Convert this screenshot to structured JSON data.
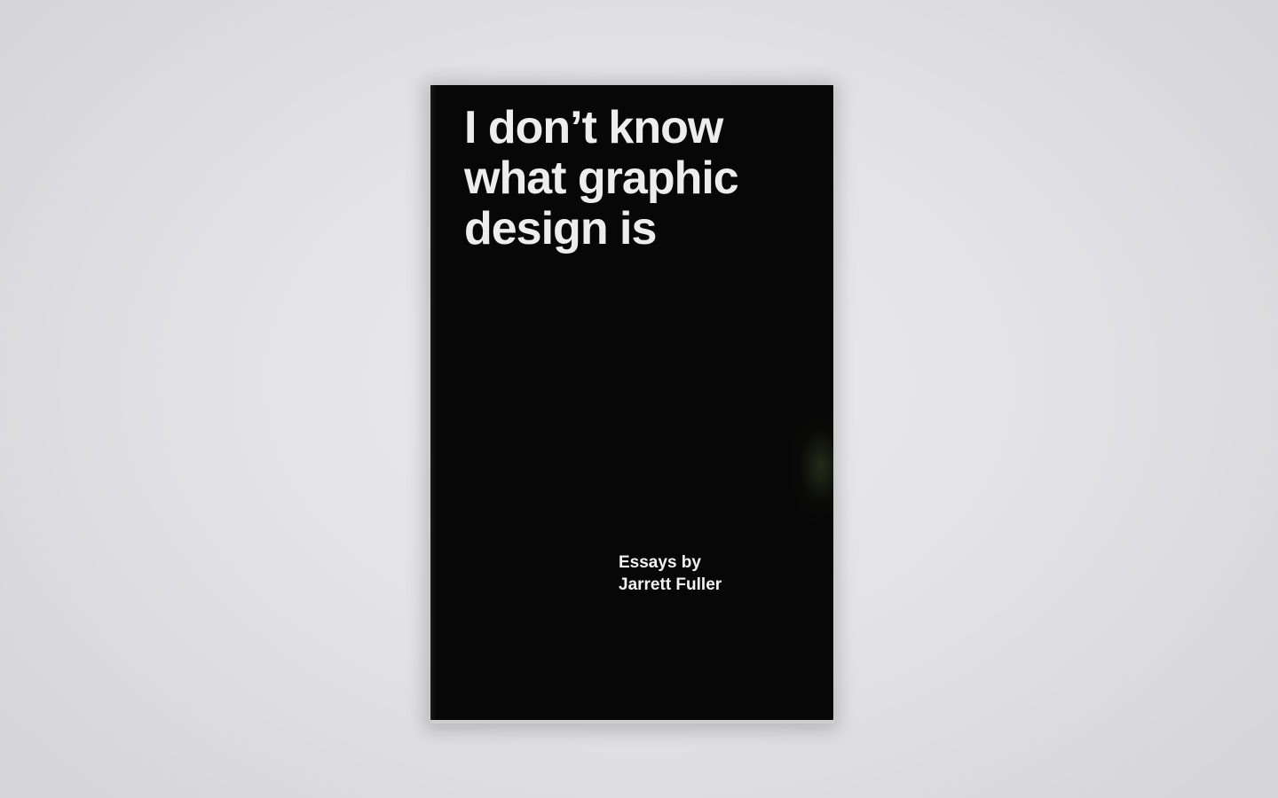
{
  "book": {
    "title_lines": [
      "I don’t know",
      "what graphic",
      "design is"
    ],
    "byline_lines": [
      "Essays by",
      "Jarrett Fuller"
    ],
    "cover_color": "#070707",
    "text_color": "#ededed"
  },
  "background": {
    "color": "#e4e4e7"
  }
}
